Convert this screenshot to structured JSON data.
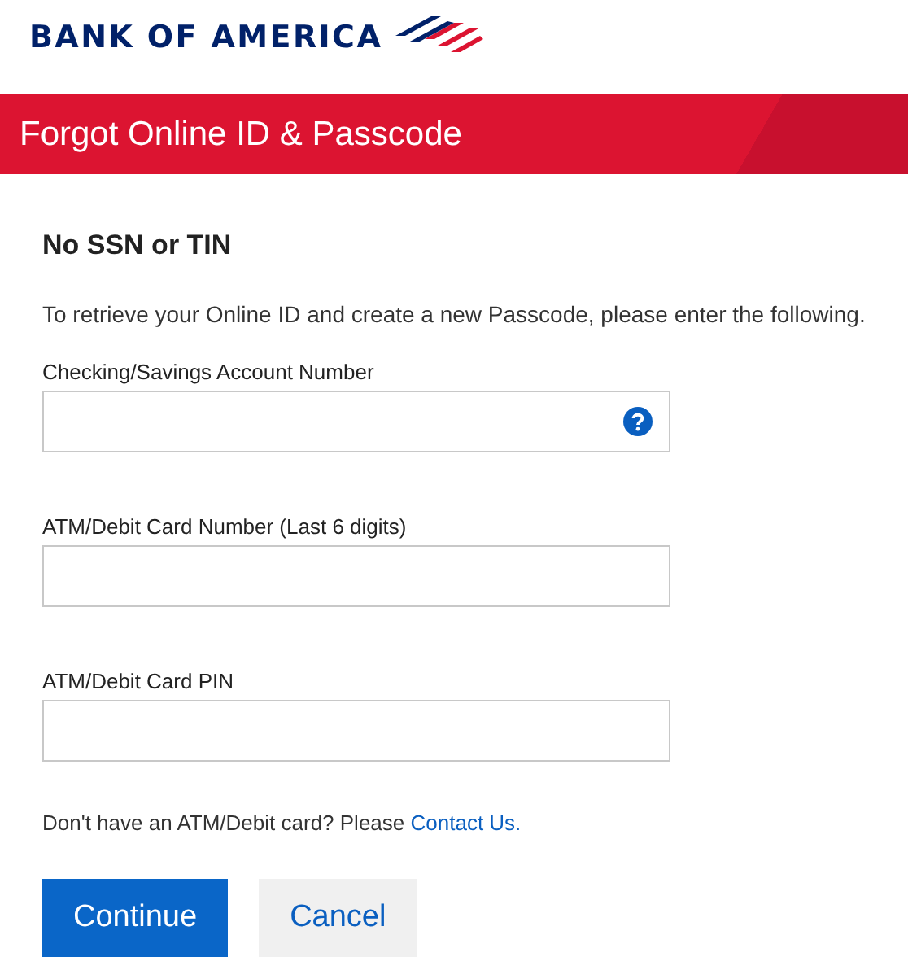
{
  "logo": {
    "text": "BANK OF AMERICA"
  },
  "banner": {
    "title": "Forgot Online ID & Passcode"
  },
  "heading": "No SSN or TIN",
  "instructions": "To retrieve your Online ID and create a new Passcode, please enter the following.",
  "fields": [
    {
      "label": "Checking/Savings Account Number",
      "help": true
    },
    {
      "label": "ATM/Debit Card Number (Last 6 digits)",
      "help": false
    },
    {
      "label": "ATM/Debit Card PIN",
      "help": false
    }
  ],
  "note": {
    "text": "Don't have an ATM/Debit card? Please",
    "link": "Contact Us."
  },
  "buttons": [
    {
      "label": "Continue",
      "kind": "primary"
    },
    {
      "label": "Cancel",
      "kind": "secondary"
    }
  ]
}
